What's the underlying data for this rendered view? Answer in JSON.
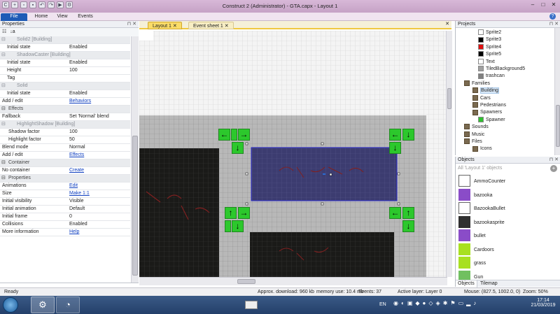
{
  "window": {
    "title": "Construct 2 (Administrator) - GTA.capx - Layout 1"
  },
  "ribbon": {
    "file": "File",
    "home": "Home",
    "view": "View",
    "events": "Events"
  },
  "properties": {
    "header": "Properties",
    "rows": [
      {
        "kind": "sec",
        "name": "Solid2 [Building]"
      },
      {
        "kind": "row",
        "name": "Initial state",
        "value": "Enabled"
      },
      {
        "kind": "sec",
        "name": "ShadowCaster [Building]"
      },
      {
        "kind": "row",
        "name": "Initial state",
        "value": "Enabled"
      },
      {
        "kind": "row",
        "name": "Height",
        "value": "100"
      },
      {
        "kind": "row",
        "name": "Tag",
        "value": ""
      },
      {
        "kind": "sec",
        "name": "Solid"
      },
      {
        "kind": "row",
        "name": "Initial state",
        "value": "Enabled"
      },
      {
        "kind": "rowl",
        "name": "Add / edit",
        "value": "Behaviors"
      },
      {
        "kind": "head",
        "name": "Effects"
      },
      {
        "kind": "rowl0",
        "name": "Fallback",
        "value": "Set 'Normal' blend"
      },
      {
        "kind": "sec",
        "name": "HighlightShadow [Building]"
      },
      {
        "kind": "rowsub",
        "name": "Shadow factor",
        "value": "100"
      },
      {
        "kind": "rowsub",
        "name": "Highlight factor",
        "value": "50"
      },
      {
        "kind": "rowl0",
        "name": "Blend mode",
        "value": "Normal"
      },
      {
        "kind": "rowl",
        "name": "Add / edit",
        "value": "Effects"
      },
      {
        "kind": "head",
        "name": "Container"
      },
      {
        "kind": "rowl",
        "name": "No container",
        "value": "Create"
      },
      {
        "kind": "head",
        "name": "Properties"
      },
      {
        "kind": "rowl",
        "name": "Animations",
        "value": "Edit"
      },
      {
        "kind": "rowl",
        "name": "Size",
        "value": "Make 1:1"
      },
      {
        "kind": "rowl0",
        "name": "Initial visibility",
        "value": "Visible"
      },
      {
        "kind": "rowl0",
        "name": "Initial animation",
        "value": "Default"
      },
      {
        "kind": "rowl0",
        "name": "Initial frame",
        "value": "0"
      },
      {
        "kind": "rowl0",
        "name": "Collisions",
        "value": "Enabled"
      },
      {
        "kind": "rowl",
        "name": "More information",
        "value": "Help"
      }
    ]
  },
  "tabs": {
    "layout": "Layout 1",
    "events": "Event sheet 1"
  },
  "project": {
    "header": "Projects",
    "items": [
      {
        "label": "Sprite2",
        "color": "#ffffff"
      },
      {
        "label": "Sprite3",
        "color": "#000000"
      },
      {
        "label": "Sprite4",
        "color": "#e01010"
      },
      {
        "label": "Sprite5",
        "color": "#000000"
      },
      {
        "label": "Text",
        "color": "#ffffff"
      },
      {
        "label": "TiledBackground5",
        "color": "#a0a0a0"
      },
      {
        "label": "trashcan",
        "color": "#808080"
      },
      {
        "label": "Families",
        "color": ""
      },
      {
        "label": "Building",
        "color": ""
      },
      {
        "label": "Cars",
        "color": ""
      },
      {
        "label": "Pedestrians",
        "color": ""
      },
      {
        "label": "Spawners",
        "color": ""
      },
      {
        "label": "Spawner",
        "color": "#30c030"
      },
      {
        "label": "Sounds",
        "color": ""
      },
      {
        "label": "Music",
        "color": ""
      },
      {
        "label": "Files",
        "color": ""
      },
      {
        "label": "Icons",
        "color": ""
      }
    ]
  },
  "objects": {
    "header": "Objects",
    "filter": "All 'Layout 1' objects",
    "items": [
      {
        "label": "AmmoCounter",
        "color": "#ffffff"
      },
      {
        "label": "bazooka",
        "color": "#8a4cc8"
      },
      {
        "label": "BazookaBullet",
        "color": "#ffffff"
      },
      {
        "label": "bazookasprite",
        "color": "#303030"
      },
      {
        "label": "bullet",
        "color": "#8a4cc8"
      },
      {
        "label": "Cardoors",
        "color": "#a8e020"
      },
      {
        "label": "grass",
        "color": "#a8e020"
      },
      {
        "label": "Gun",
        "color": "#70c060"
      }
    ],
    "tab_objects": "Objects",
    "tab_tilemap": "Tilemap"
  },
  "status": {
    "ready": "Ready",
    "download": "Approx. download: 960 kb",
    "memory": "memory use: 10.4 mb",
    "events": "Events: 37",
    "layer": "Active layer: Layer 0",
    "mouse": "Mouse: (827.5, 1002.0, 0)",
    "zoom": "Zoom: 50%"
  },
  "taskbar": {
    "lang": "EN",
    "time": "17:14",
    "date": "21/03/2019"
  }
}
